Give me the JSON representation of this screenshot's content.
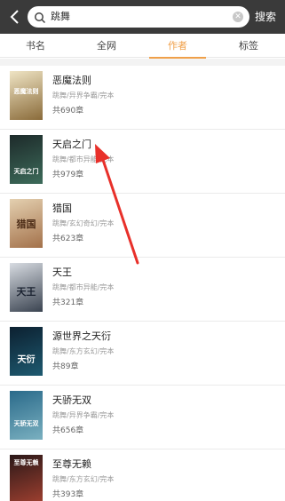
{
  "header": {
    "search_query": "跳舞",
    "clear_symbol": "✕",
    "search_button": "搜索"
  },
  "tabs": [
    {
      "label": "书名",
      "active": false
    },
    {
      "label": "全网",
      "active": false
    },
    {
      "label": "作者",
      "active": true
    },
    {
      "label": "标签",
      "active": false
    }
  ],
  "books": [
    {
      "title": "恶魔法则",
      "meta": "跳舞/异界争霸/完本",
      "chapters": "共690章",
      "cover_text": "恶魔法则",
      "cover_colors": [
        "#efe4c4",
        "#8a6b3a"
      ]
    },
    {
      "title": "天启之门",
      "meta": "跳舞/都市异能/完本",
      "chapters": "共979章",
      "cover_text": "天启之门",
      "cover_colors": [
        "#1d2a2a",
        "#3d6b5a"
      ]
    },
    {
      "title": "猎国",
      "meta": "跳舞/玄幻奇幻/完本",
      "chapters": "共623章",
      "cover_text": "猎国",
      "cover_colors": [
        "#e4d0b0",
        "#a3714a"
      ]
    },
    {
      "title": "天王",
      "meta": "跳舞/都市异能/完本",
      "chapters": "共321章",
      "cover_text": "天王",
      "cover_colors": [
        "#d8dce2",
        "#3a4350"
      ]
    },
    {
      "title": "源世界之天衍",
      "meta": "跳舞/东方玄幻/完本",
      "chapters": "共89章",
      "cover_text": "天衍",
      "cover_colors": [
        "#0c2030",
        "#1e5a70"
      ]
    },
    {
      "title": "天骄无双",
      "meta": "跳舞/异界争霸/完本",
      "chapters": "共656章",
      "cover_text": "天骄无双",
      "cover_colors": [
        "#2a6a8a",
        "#7ab0c0"
      ]
    },
    {
      "title": "至尊无赖",
      "meta": "跳舞/东方玄幻/完本",
      "chapters": "共393章",
      "cover_text": "至尊无赖",
      "cover_colors": [
        "#2a1818",
        "#a04030"
      ]
    }
  ],
  "colors": {
    "accent": "#f0a04a",
    "annotation_arrow": "#e8302a",
    "topbar": "#3a3a3a"
  }
}
